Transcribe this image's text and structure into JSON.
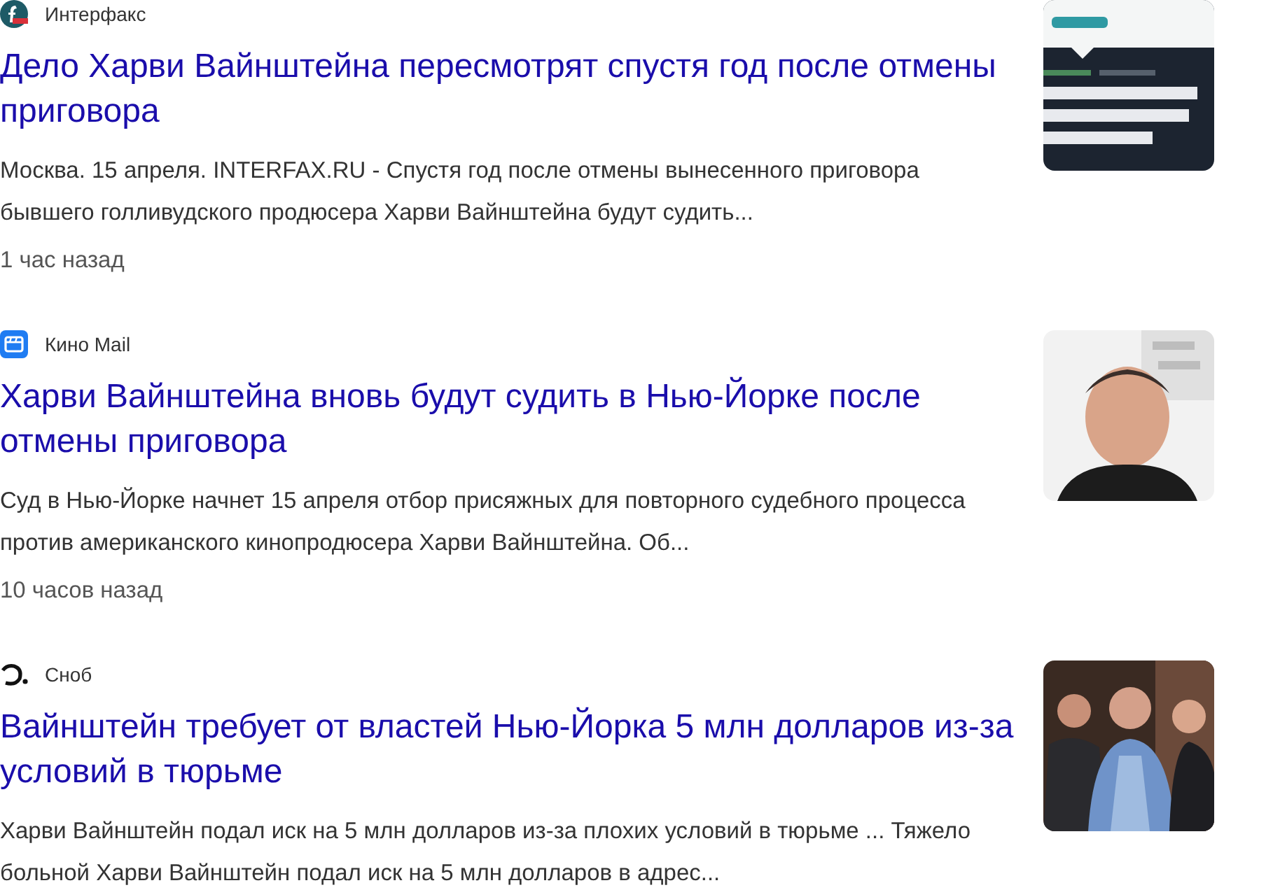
{
  "results": [
    {
      "source": {
        "name": "Интерфакс",
        "kind": "interfax"
      },
      "title": "Дело Харви Вайнштейна пересмотрят спустя год после отмены приговора",
      "snippet": "Москва. 15 апреля. INTERFAX.RU - Спустя год после отмены вынесенного приговора бывшего голливудского продюсера Харви Вайнштейна будут судить...",
      "time": "1 час назад"
    },
    {
      "source": {
        "name": "Кино Mail",
        "kind": "kino"
      },
      "title": "Харви Вайнштейна вновь будут судить в Нью-Йорке после отмены приговора",
      "snippet": "Суд в Нью-Йорке начнет 15 апреля отбор присяжных для повторного судебного процесса против американского кинопродюсера Харви Вайнштейна. Об...",
      "time": "10 часов назад"
    },
    {
      "source": {
        "name": "Сноб",
        "kind": "snob"
      },
      "title": "Вайнштейн требует от властей Нью-Йорка 5 млн долларов из-за условий в тюрьме",
      "snippet": "Харви Вайнштейн подал иск на 5 млн долларов из-за плохих условий в тюрьме ... Тяжело больной Харви Вайнштейн подал иск на 5 млн долларов в адрес..."
    }
  ]
}
